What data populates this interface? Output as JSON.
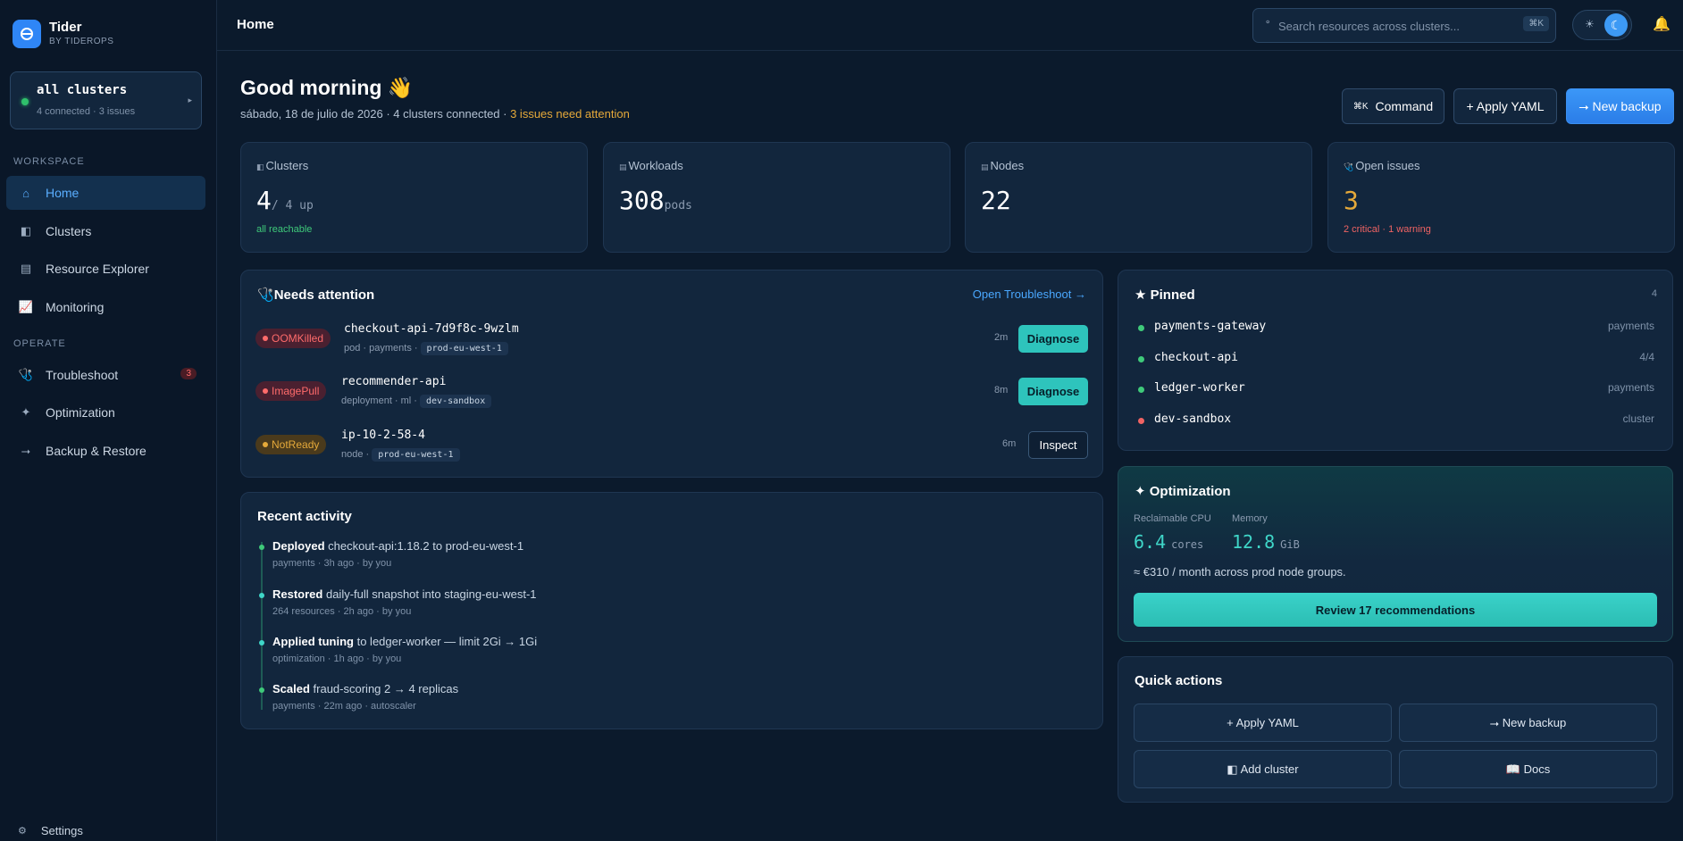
{
  "brand": {
    "name": "Tider",
    "sub": "BY TIDEROPS",
    "accent": "#2f86f6"
  },
  "cluster_switcher": {
    "name": "all clusters",
    "meta": "4 connected · 3 issues",
    "status_color": "#2fc06b"
  },
  "sidebar": {
    "workspace_label": "WORKSPACE",
    "operate_label": "OPERATE",
    "items": [
      {
        "label": "Home",
        "icon": "home-icon",
        "glyph": "⌂"
      },
      {
        "label": "Clusters",
        "icon": "clusters-icon",
        "glyph": "◧"
      },
      {
        "label": "Resource Explorer",
        "icon": "list-icon",
        "glyph": "▤"
      },
      {
        "label": "Monitoring",
        "icon": "chart-icon",
        "glyph": "📈"
      },
      {
        "label": "Troubleshoot",
        "icon": "stethoscope-icon",
        "glyph": "🩺",
        "badge": "3"
      },
      {
        "label": "Optimization",
        "icon": "sparkle-icon",
        "glyph": "✦"
      },
      {
        "label": "Backup & Restore",
        "icon": "arrow-right-icon",
        "glyph": "⭢"
      }
    ],
    "settings": {
      "label": "Settings",
      "icon": "gear-icon",
      "glyph": "⚙"
    }
  },
  "topbar": {
    "title": "Home",
    "search_placeholder": "Search resources across clusters...",
    "search_shortcut": "⌘K"
  },
  "header": {
    "greeting": "Good morning 👋",
    "date": "sábado, 18 de julio de 2026 · 4 clusters connected · ",
    "issues": "3 issues need attention",
    "buttons": {
      "command": "Command",
      "command_kbd": "⌘K",
      "apply_yaml": "+ Apply YAML",
      "new_backup": "⭢ New backup"
    }
  },
  "stats": [
    {
      "label": "Clusters",
      "icon": "◧",
      "value": "4",
      "suffix": "/ 4 up",
      "foot": "all reachable",
      "foot_color": "green"
    },
    {
      "label": "Workloads",
      "icon": "▤",
      "value": "308",
      "suffix": "pods",
      "foot": "",
      "foot_color": ""
    },
    {
      "label": "Nodes",
      "icon": "▤",
      "value": "22",
      "suffix": "",
      "foot": "",
      "foot_color": ""
    },
    {
      "label": "Open issues",
      "icon": "🩺",
      "value": "3",
      "suffix": "",
      "foot": "2 critical · 1 warning",
      "foot_color": "red"
    }
  ],
  "attention": {
    "title": "Needs attention",
    "link": "Open Troubleshoot →",
    "rows": [
      {
        "badge": "OOMKilled",
        "severity": "err",
        "name": "checkout-api-7d9f8c-9wzlm",
        "meta": "pod · payments ·",
        "tag": "prod-eu-west-1",
        "age": "2m",
        "action": "Diagnose"
      },
      {
        "badge": "ImagePull",
        "severity": "err",
        "name": "recommender-api",
        "meta": "deployment · ml ·",
        "tag": "dev-sandbox",
        "age": "8m",
        "action": "Diagnose"
      },
      {
        "badge": "NotReady",
        "severity": "warn",
        "name": "ip-10-2-58-4",
        "meta": "node ·",
        "tag": "prod-eu-west-1",
        "age": "6m",
        "action": "Inspect"
      }
    ]
  },
  "activity": {
    "title": "Recent activity",
    "items": [
      {
        "verb": "Deployed",
        "text": " checkout-api:1.18.2 to prod-eu-west-1",
        "meta": "payments · 3h ago · by you",
        "color": "#3fca7a"
      },
      {
        "verb": "Restored",
        "text": " daily-full snapshot into staging-eu-west-1",
        "meta": "264 resources · 2h ago · by you",
        "color": "#3fd6c8"
      },
      {
        "verb": "Applied tuning",
        "text": " to ledger-worker — limit 2Gi → 1Gi",
        "meta": "optimization · 1h ago · by you",
        "color": "#3fd6c8"
      },
      {
        "verb": "Scaled",
        "text": " fraud-scoring 2 → 4 replicas",
        "meta": "payments · 22m ago · autoscaler",
        "color": "#3fca7a"
      }
    ]
  },
  "pinned": {
    "title": "★ Pinned",
    "count": "4",
    "items": [
      {
        "name": "payments-gateway",
        "ns": "payments",
        "color": "#3fca7a"
      },
      {
        "name": "checkout-api",
        "ns": "4/4",
        "color": "#3fca7a"
      },
      {
        "name": "ledger-worker",
        "ns": "payments",
        "color": "#3fca7a"
      },
      {
        "name": "dev-sandbox",
        "ns": "cluster",
        "color": "#f06363"
      }
    ]
  },
  "optimization": {
    "title": "✦ Optimization",
    "cpu_label": "Reclaimable CPU",
    "cpu_value": "6.4",
    "cpu_unit": "cores",
    "mem_label": "Memory",
    "mem_value": "12.8",
    "mem_unit": "GiB",
    "summary": "≈ €310 / month across prod node groups.",
    "button": "Review 17 recommendations"
  },
  "quick_actions": {
    "title": "Quick actions",
    "items": [
      "+ Apply YAML",
      "⭢ New backup",
      "◧ Add cluster",
      "📖 Docs"
    ]
  }
}
